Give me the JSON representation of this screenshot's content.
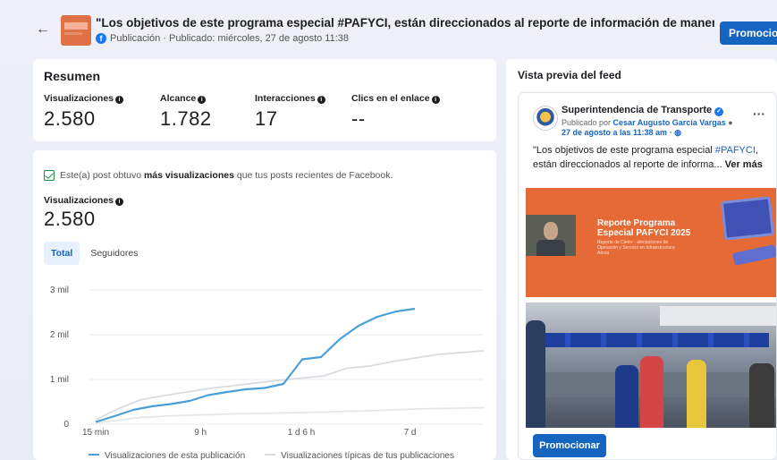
{
  "header": {
    "back_icon": "arrow-left-icon",
    "title": "\"Los objetivos de este programa especial #PAFYCI, están direccionados al reporte de información de manera clara y precisa por ...",
    "meta": "Publicación · Publicado: miércoles, 27 de agosto 11:38",
    "platform_icon": "facebook-icon",
    "promote_label": "Promocionar"
  },
  "summary": {
    "title": "Resumen",
    "metrics": [
      {
        "label": "Visualizaciones",
        "value": "2.580"
      },
      {
        "label": "Alcance",
        "value": "1.782"
      },
      {
        "label": "Interacciones",
        "value": "17"
      },
      {
        "label": "Clics en el enlace",
        "value": "--"
      }
    ]
  },
  "performance": {
    "notice_prefix": "Este(a) post obtuvo ",
    "notice_bold": "más visualizaciones",
    "notice_suffix": " que tus posts recientes de Facebook.",
    "metric_label": "Visualizaciones",
    "metric_value": "2.580",
    "tabs": [
      "Total",
      "Seguidores"
    ],
    "active_tab": "Total"
  },
  "chart_data": {
    "type": "line",
    "x_ticks": [
      "15 min",
      "9 h",
      "1 d 6 h",
      "7 d"
    ],
    "y_ticks": [
      "0",
      "1 mil",
      "2 mil",
      "3 mil"
    ],
    "ylim": [
      0,
      3000
    ],
    "series": [
      {
        "name": "Visualizaciones de esta publicación",
        "color": "#4a9fd8",
        "values": [
          50,
          180,
          320,
          400,
          450,
          520,
          650,
          720,
          780,
          810,
          900,
          1450,
          1500,
          1900,
          2200,
          2400,
          2520,
          2580
        ]
      },
      {
        "name": "Visualizaciones típicas de tus publicaciones",
        "color": "#d9dbe0",
        "values": [
          100,
          350,
          550,
          640,
          720,
          800,
          860,
          920,
          980,
          1030,
          1080,
          1250,
          1300,
          1400,
          1480,
          1560,
          1600,
          1640
        ]
      },
      {
        "name": "",
        "color": "#e4e6ea",
        "values": [
          30,
          90,
          150,
          180,
          200,
          215,
          230,
          240,
          250,
          260,
          270,
          290,
          300,
          320,
          340,
          350,
          360,
          370
        ]
      }
    ]
  },
  "preview": {
    "title": "Vista previa del feed",
    "page_name": "Superintendencia de Transporte",
    "by_prefix": "Publicado por ",
    "by_name": "Cesar Augusto García Vargas",
    "date": "27 de agosto a las 11:38 am ·",
    "text_prefix": "\"Los objetivos de este programa especial ",
    "hashtag": "#PAFYCI",
    "text_suffix": ", están direccionados al reporte de informa... ",
    "see_more": "Ver más",
    "image_title": "Reporte Programa Especial PAFYCI 2025",
    "image_sub": "Reporte de Cierre - afectaciones de Operación y Servicio en Infraestructura Aérea",
    "promote_label": "Promocionar"
  }
}
